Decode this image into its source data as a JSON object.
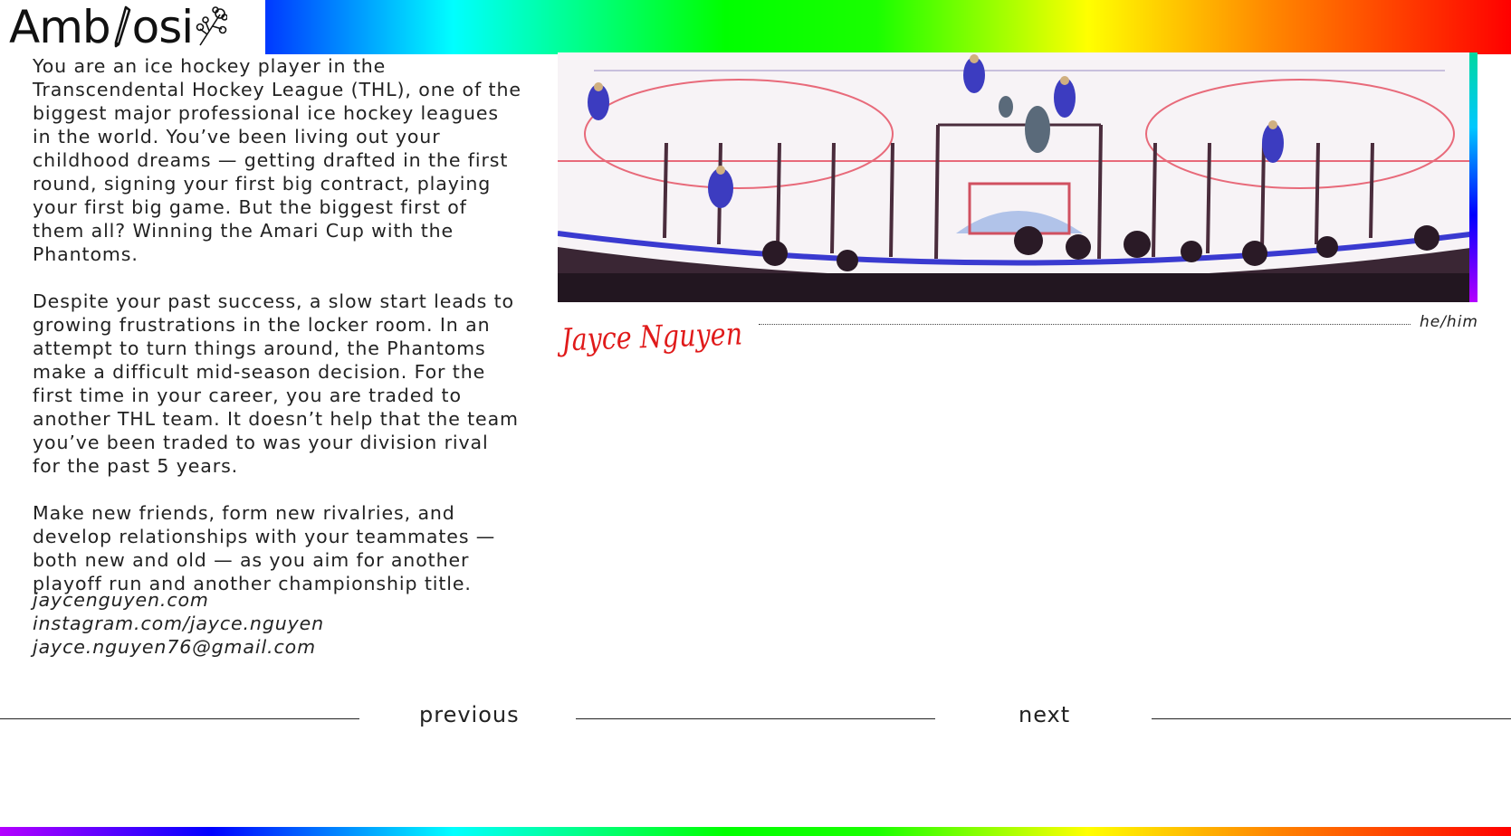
{
  "brand": {
    "logo_left": "Amb",
    "logo_right": "osi",
    "flower_icon": "flower-icon",
    "pen_icon": "pen-icon"
  },
  "story": {
    "paragraphs": [
      "You are an ice hockey player in the Transcendental Hockey League (THL), one of the biggest major professional ice hockey leagues in the world. You’ve been living out your childhood dreams — getting drafted in the first round, signing your first big contract, playing your first big game. But the biggest first of them all? Winning the Amari Cup with the Phantoms.",
      "Despite your past success, a slow start leads to growing frustrations in the locker room. In an attempt to turn things around, the Phantoms make a difficult mid-season decision. For the first time in your career, you are traded to another THL team. It doesn’t help that the team you’ve been traded to was your division rival for the past 5 years.",
      "Make new friends, form new rivalries, and develop relationships with your teammates — both new and old — as you aim for another playoff run and another championship title."
    ]
  },
  "author": {
    "name": "Jayce Nguyen",
    "pronouns": "he/him",
    "links": [
      "jaycenguyen.com",
      "instagram.com/jayce.nguyen",
      "jayce.nguyen76@gmail.com"
    ]
  },
  "nav": {
    "previous_label": "previous",
    "next_label": "next"
  },
  "colors": {
    "signature": "#e01a1a",
    "text": "#222222",
    "rink_line_red": "#e86a7a",
    "rink_line_blue": "#3a3ad0"
  }
}
